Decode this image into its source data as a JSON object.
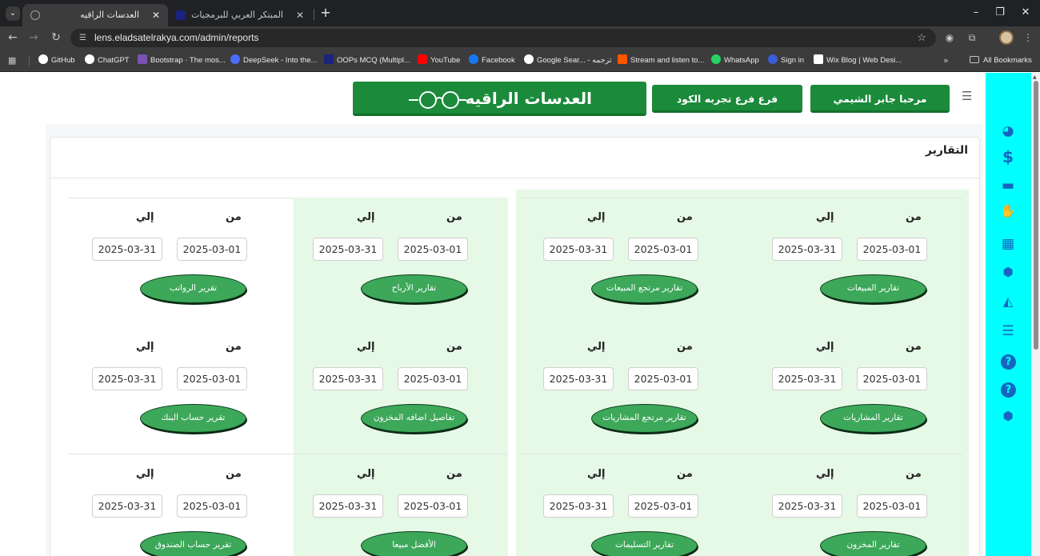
{
  "browser": {
    "tabs": [
      {
        "title": "العدسات الراقيه",
        "active": true
      },
      {
        "title": "المبتكر العربي للبرمجيات",
        "active": false
      }
    ],
    "url": "lens.eladsatelrakya.com/admin/reports",
    "bookmarks": [
      {
        "label": "GitHub",
        "color": "#ffffff"
      },
      {
        "label": "ChatGPT",
        "color": "#ffffff"
      },
      {
        "label": "Bootstrap · The mos...",
        "color": "#7952b3"
      },
      {
        "label": "DeepSeek - Into the...",
        "color": "#4d6bfe"
      },
      {
        "label": "OOPs MCQ (Multipl...",
        "color": "#1a237e"
      },
      {
        "label": "YouTube",
        "color": "#ff0000"
      },
      {
        "label": "Facebook",
        "color": "#1877f2"
      },
      {
        "label": "Google Sear... - ترجمه",
        "color": "#ffffff"
      },
      {
        "label": "Stream and listen to...",
        "color": "#ff5500"
      },
      {
        "label": "WhatsApp",
        "color": "#25d366"
      },
      {
        "label": "Sign in",
        "color": "#3b5bdb"
      },
      {
        "label": "Wix Blog | Web Desi...",
        "color": "#ffffff"
      }
    ],
    "all_bookmarks_label": "All Bookmarks"
  },
  "header": {
    "brand_title": "العدسات الراقيه",
    "welcome_button": "مرحبا جابر الشيمي",
    "branch_button": "فرع فرع تجربه الكود"
  },
  "sidebar_icons": [
    "dashboard-icon",
    "dollar-icon",
    "credit-card-icon",
    "handshake-icon",
    "calculator-icon",
    "cubes-icon",
    "area-chart-icon",
    "sliders-icon",
    "question-circle-icon",
    "question-circle-icon",
    "cubes-icon"
  ],
  "page": {
    "title": "التقارير",
    "from_label": "من",
    "to_label": "إلي",
    "reports": [
      [
        {
          "button": "تقارير المبيعات",
          "from": "2025-03-01",
          "to": "2025-03-31"
        },
        {
          "button": "تقارير مرتجع المبيعات",
          "from": "2025-03-01",
          "to": "2025-03-31"
        },
        {
          "button": "تقارير الأرباح",
          "from": "2025-03-01",
          "to": "2025-03-31"
        },
        {
          "button": "تقرير الرواتب",
          "from": "2025-03-01",
          "to": "2025-03-31"
        }
      ],
      [
        {
          "button": "تقارير المشاريات",
          "from": "2025-03-01",
          "to": "2025-03-31"
        },
        {
          "button": "تقارير مرتجع المشاريات",
          "from": "2025-03-01",
          "to": "2025-03-31"
        },
        {
          "button": "تفاصيل اضافه المخزون",
          "from": "2025-03-01",
          "to": "2025-03-31"
        },
        {
          "button": "تقرير حساب البنك",
          "from": "2025-03-01",
          "to": "2025-03-31"
        }
      ],
      [
        {
          "button": "تقارير المخزون",
          "from": "2025-03-01",
          "to": "2025-03-31"
        },
        {
          "button": "تقارير التسليمات",
          "from": "2025-03-01",
          "to": "2025-03-31"
        },
        {
          "button": "الأفضل مبيعا",
          "from": "2025-03-01",
          "to": "2025-03-31"
        },
        {
          "button": "تقرير حساب الصندوق",
          "from": "2025-03-01",
          "to": "2025-03-31"
        }
      ]
    ]
  }
}
